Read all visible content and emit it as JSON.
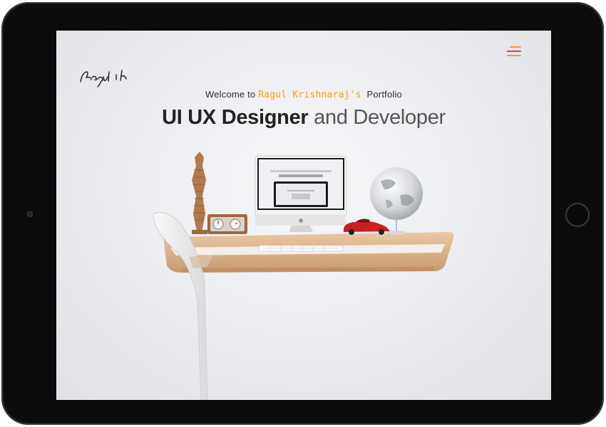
{
  "header": {
    "welcome_prefix": "Welcome to",
    "owner_name": "Ragul Krishnaraj's",
    "welcome_suffix": "Portfolio",
    "headline_strong": "UI UX Designer",
    "headline_light": "and Developer"
  },
  "logo": {
    "signature_text": "Ragul .k"
  },
  "menu": {
    "icon": "hamburger-menu-icon"
  },
  "colors": {
    "accent_orange": "#f0a21e",
    "accent_red": "#e8443a",
    "frame": "#0c0c0c"
  }
}
